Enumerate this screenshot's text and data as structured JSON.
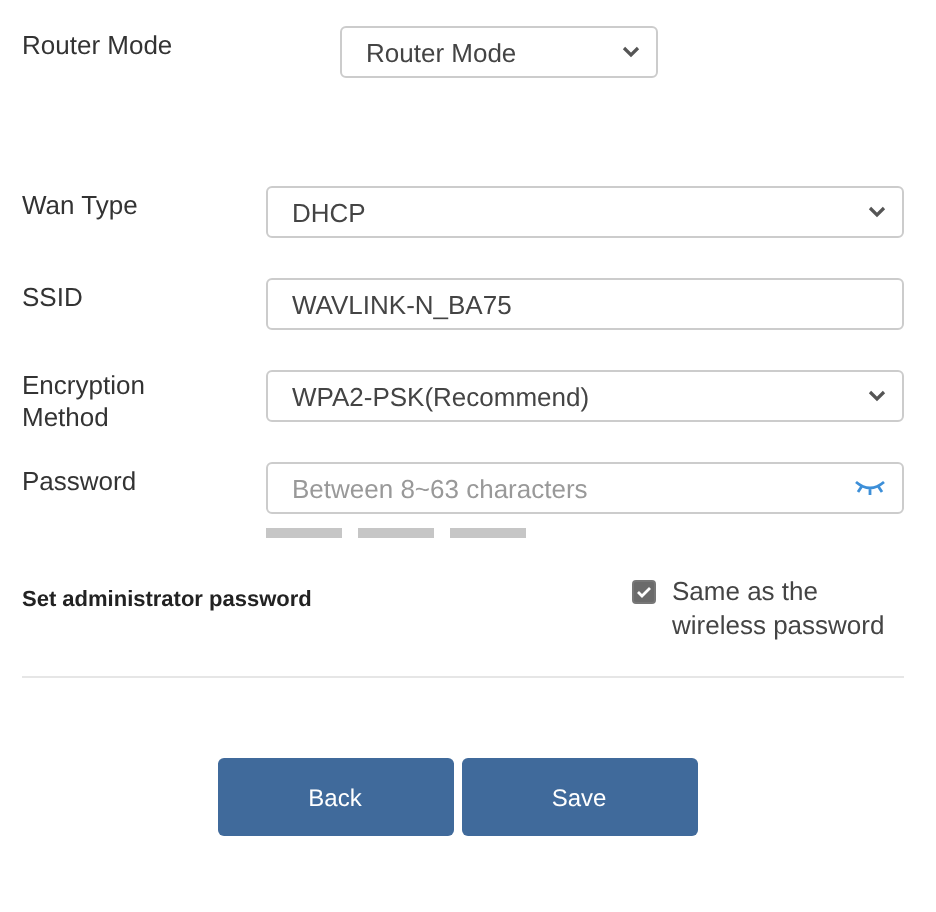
{
  "mode": {
    "label": "Router Mode",
    "value": "Router Mode"
  },
  "fields": [
    {
      "kind": "select",
      "label": "Wan Type",
      "value": "DHCP"
    },
    {
      "kind": "text",
      "label": "SSID",
      "value": "WAVLINK-N_BA75"
    },
    {
      "kind": "select",
      "label": "Encryption Method",
      "value": "WPA2-PSK(Recommend)"
    },
    {
      "kind": "password",
      "label": "Password",
      "placeholder": "Between 8~63 characters"
    }
  ],
  "admin": {
    "label": "Set administrator password",
    "checkbox": {
      "label": "Same as the wireless password",
      "checked": true
    }
  },
  "buttons": [
    "Back",
    "Save"
  ]
}
